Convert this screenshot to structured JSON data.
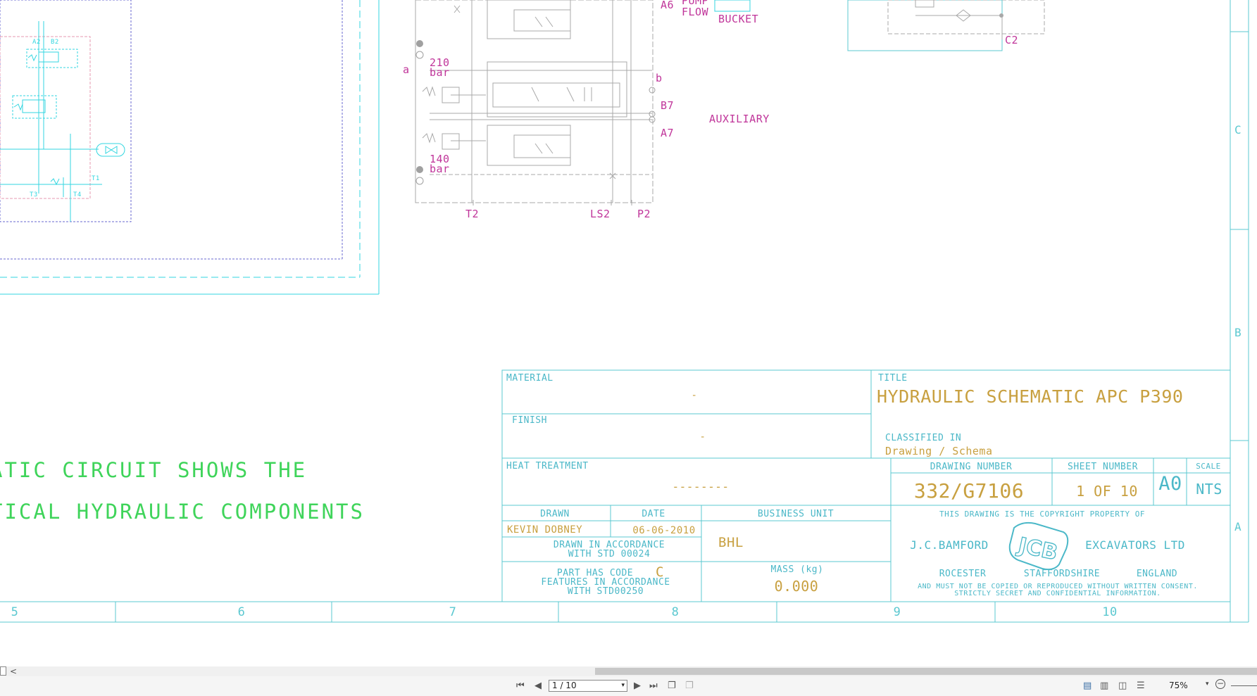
{
  "schematic": {
    "labels": {
      "a": "a",
      "b": "b",
      "p210": "210",
      "bar1": "bar",
      "p140": "140",
      "bar2": "bar",
      "t2": "T2",
      "ls2": "LS2",
      "p2": "P2",
      "a6": "A6",
      "pump": "PUMP",
      "flow": "FLOW",
      "bucket": "BUCKET",
      "b7": "B7",
      "a7": "A7",
      "auxiliary": "AUXILIARY",
      "c2": "C2",
      "a2": "A2",
      "b2": "B2",
      "t1": "T1",
      "t3": "T3",
      "t4": "T4"
    },
    "note_line1": "ATIC CIRCUIT SHOWS THE",
    "note_line2": "TICAL HYDRAULIC COMPONENTS"
  },
  "title_block": {
    "material_label": "MATERIAL",
    "material_value": "-",
    "finish_label": "FINISH",
    "finish_value": "-",
    "heat_label": "HEAT TREATMENT",
    "heat_value": "--------",
    "title_label": "TITLE",
    "title_value": "HYDRAULIC SCHEMATIC APC P390",
    "classified_label": "CLASSIFIED IN",
    "classified_value": "Drawing / Schema",
    "drawing_number_label": "DRAWING NUMBER",
    "drawing_number": "332/G7106",
    "sheet_label": "SHEET NUMBER",
    "sheet_value": "1 OF 10",
    "size": "A0",
    "scale_label": "SCALE",
    "scale_value": "NTS",
    "drawn_label": "DRAWN",
    "drawn_value": "KEVIN DOBNEY",
    "date_label": "DATE",
    "date_value": "06-06-2010",
    "bu_label": "BUSINESS UNIT",
    "bu_value": "BHL",
    "accord1": "DRAWN IN ACCORDANCE",
    "accord2": "WITH STD 00024",
    "partcode": "PART HAS CODE",
    "partcode_value": "C",
    "features1": "FEATURES IN ACCORDANCE",
    "features2": "WITH STD00250",
    "mass_label": "MASS (kg)",
    "mass_value": "0.000",
    "copyright1": "THIS DRAWING IS THE COPYRIGHT PROPERTY OF",
    "company_left": "J.C.BAMFORD",
    "company_right": "EXCAVATORS LTD",
    "logo_text": "JCB",
    "place1": "ROCESTER",
    "place2": "STAFFORDSHIRE",
    "place3": "ENGLAND",
    "copyright2": "AND MUST NOT BE COPIED OR REPRODUCED WITHOUT WRITTEN CONSENT.",
    "copyright3": "STRICTLY SECRET AND CONFIDENTIAL INFORMATION."
  },
  "grid": {
    "columns": [
      "5",
      "6",
      "7",
      "8",
      "9",
      "10"
    ],
    "rows": [
      "C",
      "B",
      "A"
    ]
  },
  "viewer": {
    "page_value": "1 / 10",
    "zoom": "75%"
  },
  "colors": {
    "frame": "#5bc8d0",
    "magenta": "#c0359a",
    "gold": "#c8a040",
    "note_green": "#3fd45a",
    "cyan_circuit": "#33d6e0"
  }
}
